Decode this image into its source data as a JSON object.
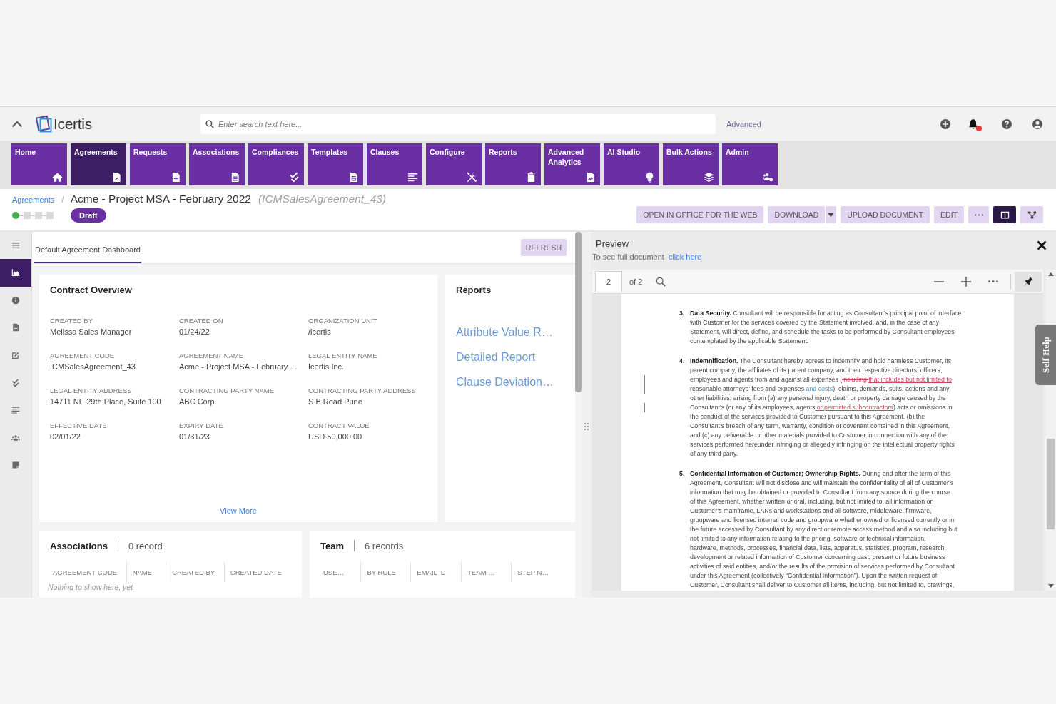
{
  "header": {
    "logo_text": "Icertis",
    "search": {
      "placeholder": "Enter search text here..."
    },
    "advanced_link": "Advanced",
    "notifications_unread": true
  },
  "nav_tiles": [
    {
      "label": "Home",
      "selected": false
    },
    {
      "label": "Agreements",
      "selected": true
    },
    {
      "label": "Requests",
      "selected": false
    },
    {
      "label": "Associations",
      "selected": false
    },
    {
      "label": "Compliances",
      "selected": false
    },
    {
      "label": "Templates",
      "selected": false
    },
    {
      "label": "Clauses",
      "selected": false
    },
    {
      "label": "Configure",
      "selected": false
    },
    {
      "label": "Reports",
      "selected": false
    },
    {
      "label": "Advanced Analytics",
      "selected": false
    },
    {
      "label": "AI Studio",
      "selected": false
    },
    {
      "label": "Bulk Actions",
      "selected": false
    },
    {
      "label": "Admin",
      "selected": false
    }
  ],
  "breadcrumb": {
    "parent": "Agreements",
    "separator": "/",
    "title": "Acme - Project MSA - February 2022",
    "code": "(ICMSalesAgreement_43)"
  },
  "stages": [
    {
      "completed": true
    },
    {
      "completed": false
    },
    {
      "completed": false
    },
    {
      "completed": false
    }
  ],
  "status_badge": "Draft",
  "actions": [
    {
      "kind": "button",
      "label": "OPEN IN OFFICE FOR THE WEB"
    },
    {
      "kind": "split",
      "label": "DOWNLOAD"
    },
    {
      "kind": "button",
      "label": "UPLOAD DOCUMENT"
    },
    {
      "kind": "button",
      "label": "EDIT"
    },
    {
      "kind": "more"
    }
  ],
  "view_toggles": [
    {
      "selected": true
    },
    {
      "selected": false
    }
  ],
  "sidebar": {
    "items": [
      {
        "selected": true
      },
      {
        "selected": false
      },
      {
        "selected": false
      },
      {
        "selected": false
      },
      {
        "selected": false
      },
      {
        "selected": false
      },
      {
        "selected": false
      },
      {
        "selected": false
      }
    ]
  },
  "dashboard": {
    "tabs": [
      {
        "label": "Default Agreement Dashboard",
        "selected": true
      }
    ],
    "refresh_button": "REFRESH",
    "contract_overview": {
      "title": "Contract Overview",
      "fields": [
        {
          "label": "CREATED BY",
          "value": "Melissa Sales Manager"
        },
        {
          "label": "CREATED ON",
          "value": "01/24/22"
        },
        {
          "label": "ORGANIZATION UNIT",
          "value": "/icertis"
        },
        {
          "label": "AGREEMENT CODE",
          "value": "ICMSalesAgreement_43"
        },
        {
          "label": "AGREEMENT NAME",
          "value": "Acme - Project MSA - February …"
        },
        {
          "label": "LEGAL ENTITY NAME",
          "value": "Icertis Inc."
        },
        {
          "label": "LEGAL ENTITY ADDRESS",
          "value": "14711 NE 29th Place, Suite 100"
        },
        {
          "label": "CONTRACTING PARTY NAME",
          "value": "ABC Corp"
        },
        {
          "label": "CONTRACTING PARTY ADDRESS",
          "value": "S B Road Pune"
        },
        {
          "label": "EFFECTIVE DATE",
          "value": "02/01/22"
        },
        {
          "label": "EXPIRY DATE",
          "value": "01/31/23"
        },
        {
          "label": "CONTRACT VALUE",
          "value": "USD 50,000.00"
        }
      ],
      "view_more": "View More"
    },
    "reports": {
      "title": "Reports",
      "links": [
        "Attribute Value R…",
        "Detailed Report",
        "Clause Deviation…"
      ]
    },
    "associations": {
      "title": "Associations",
      "count": "0 record",
      "columns": [
        "AGREEMENT CODE",
        "NAME",
        "CREATED BY",
        "CREATED DATE"
      ],
      "empty_message": "Nothing to show here, yet"
    },
    "team": {
      "title": "Team",
      "count": "6 records",
      "columns": [
        "USE…",
        "BY RULE",
        "EMAIL ID",
        "TEAM …",
        "STEP N…"
      ]
    }
  },
  "preview": {
    "title": "Preview",
    "hint": "To see full document",
    "link": "click here",
    "page": "2",
    "page_total": "of 2",
    "self_help_tab": "Self Help",
    "document": {
      "paragraphs": [
        {
          "number": "3.",
          "lines": [
            [
              {
                "kind": "plain",
                "text": "**Data Security.** Consultant will be responsible for acting as Consultant’s principal point of interface"
              }
            ],
            [
              {
                "kind": "plain",
                "text": "with Customer for the services covered by the Statement involved, and, in the case of any"
              }
            ],
            [
              {
                "kind": "plain",
                "text": "Statement, will direct, define, and schedule the tasks to be performed by Consultant employees"
              }
            ],
            [
              {
                "kind": "plain",
                "text": "contemplated by the applicable Statement."
              }
            ]
          ]
        },
        {
          "number": "4.",
          "lines": [
            [
              {
                "kind": "plain",
                "text": "**Indemnification.** The Consultant hereby agrees to indemnify and hold harmless Customer, its"
              }
            ],
            [
              {
                "kind": "plain",
                "text": "parent company, the affiliates of its parent company, and their respective directors, officers,"
              }
            ],
            [
              {
                "kind": "plain",
                "text": "employees and agents from and against all expenses ("
              },
              {
                "kind": "deleted",
                "text": "including "
              },
              {
                "kind": "inserted",
                "text": "that includes but not limited to"
              }
            ],
            [
              {
                "kind": "plain",
                "text": "reasonable attorneys’ fees and expenses"
              },
              {
                "kind": "inserted_alt",
                "text": " and costs"
              },
              {
                "kind": "plain",
                "text": "), claims, demands, suits, actions and any"
              }
            ],
            [
              {
                "kind": "plain",
                "text": "other liabilities, arising from (a) any personal injury, death or property damage caused by the"
              }
            ],
            [
              {
                "kind": "plain",
                "text": "Consultant’s (or any of its employees, agents"
              },
              {
                "kind": "inserted",
                "text": " or permitted subcontractors"
              },
              {
                "kind": "plain",
                "text": ") acts or omissions in"
              }
            ],
            [
              {
                "kind": "plain",
                "text": "the conduct of the services provided to Customer pursuant to this Agreement, (b) the"
              }
            ],
            [
              {
                "kind": "plain",
                "text": "Consultant’s breach of any term, warranty, condition or covenant contained in this Agreement,"
              }
            ],
            [
              {
                "kind": "plain",
                "text": "and (c) any deliverable or other materials provided to Customer in connection with any of the"
              }
            ],
            [
              {
                "kind": "plain",
                "text": "services performed hereunder infringing or allegedly infringing on the intellectual property rights"
              }
            ],
            [
              {
                "kind": "plain",
                "text": "of any third party."
              }
            ]
          ]
        },
        {
          "number": "5.",
          "lines": [
            [
              {
                "kind": "plain",
                "text": "**Confidential Information of Customer; Ownership Rights.** During and after the term of this"
              }
            ],
            [
              {
                "kind": "plain",
                "text": "Agreement, Consultant will not disclose and will maintain the confidentiality of all of Customer’s"
              }
            ],
            [
              {
                "kind": "plain",
                "text": "information that may be obtained or provided to Consultant from any source during the course"
              }
            ],
            [
              {
                "kind": "plain",
                "text": "of this Agreement, whether written or oral, including, but not limited to, all information on"
              }
            ],
            [
              {
                "kind": "plain",
                "text": "Customer’s mainframe, LANs and workstations and all software, middleware, firmware,"
              }
            ],
            [
              {
                "kind": "plain",
                "text": "groupware and licensed internal code and groupware whether owned or licensed currently or in"
              }
            ],
            [
              {
                "kind": "plain",
                "text": "the future accessed by Consultant by any direct or remote access method and also including but"
              }
            ],
            [
              {
                "kind": "plain",
                "text": "not limited to any information relating to the pricing, software or technical information,"
              }
            ],
            [
              {
                "kind": "plain",
                "text": "hardware, methods, processes, financial data, lists, apparatus, statistics, program, research,"
              }
            ],
            [
              {
                "kind": "plain",
                "text": "development or related information of Customer concerning past, present or future business"
              }
            ],
            [
              {
                "kind": "plain",
                "text": "activities of said entities, and/or the results of the provision of services performed by Consultant"
              }
            ],
            [
              {
                "kind": "plain",
                "text": "under this Agreement (collectively “Confidential Information”). Upon the written request of"
              }
            ],
            [
              {
                "kind": "plain",
                "text": "Customer, Consultant shall deliver to Customer all items, including, but not limited to, drawings,"
              }
            ]
          ]
        }
      ]
    }
  }
}
